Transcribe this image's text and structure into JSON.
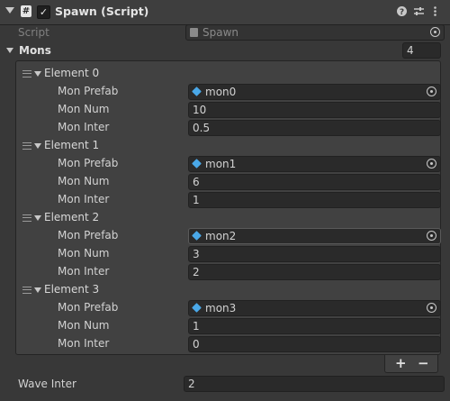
{
  "header": {
    "script_icon": "#",
    "enabled_check": "✓",
    "title": "Spawn (Script)",
    "icons": [
      "help-icon",
      "preset-sliders-icon",
      "more-vert-icon"
    ]
  },
  "script_row": {
    "label": "Script",
    "value": "Spawn"
  },
  "mons": {
    "label": "Mons",
    "size": "4"
  },
  "elements": [
    {
      "label": "Element 0",
      "prefab_label": "Mon Prefab",
      "prefab": "mon0",
      "num_label": "Mon Num",
      "num": "10",
      "inter_label": "Mon Inter",
      "inter": "0.5"
    },
    {
      "label": "Element 1",
      "prefab_label": "Mon Prefab",
      "prefab": "mon1",
      "num_label": "Mon Num",
      "num": "6",
      "inter_label": "Mon Inter",
      "inter": "1"
    },
    {
      "label": "Element 2",
      "prefab_label": "Mon Prefab",
      "prefab": "mon2",
      "num_label": "Mon Num",
      "num": "3",
      "inter_label": "Mon Inter",
      "inter": "2"
    },
    {
      "label": "Element 3",
      "prefab_label": "Mon Prefab",
      "prefab": "mon3",
      "num_label": "Mon Num",
      "num": "1",
      "inter_label": "Mon Inter",
      "inter": "0"
    }
  ],
  "list_buttons": {
    "add": "+",
    "remove": "−"
  },
  "wave_inter": {
    "label": "Wave Inter",
    "value": "2"
  },
  "colors": {
    "background": "#383838",
    "field": "#2a2a2a",
    "prefab_icon": "#4aa8e8"
  }
}
